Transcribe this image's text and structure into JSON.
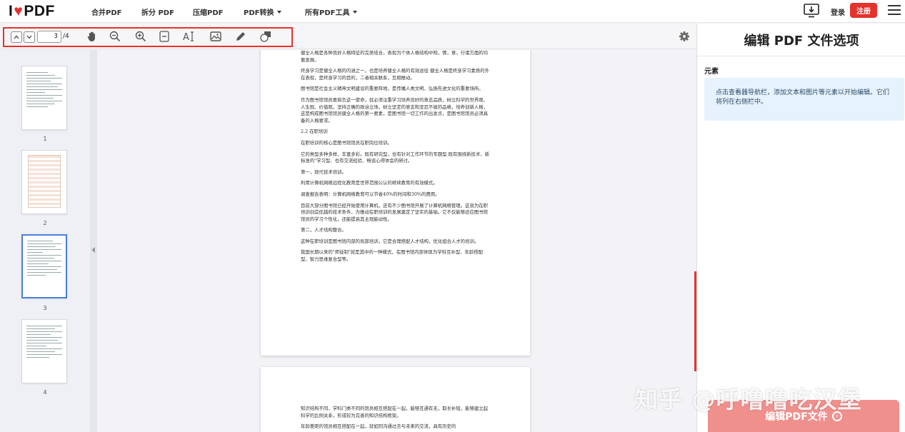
{
  "brand": {
    "logo_left": "I",
    "logo_right": "PDF",
    "accent": "#e5322d"
  },
  "nav": {
    "items": [
      "合并PDF",
      "拆分 PDF",
      "压缩PDF",
      "PDF转换",
      "所有PDF工具"
    ],
    "login": "登录",
    "signup": "注册"
  },
  "toolbar": {
    "page_current": "3",
    "page_total": "/4",
    "icons": [
      "chevron-up-icon",
      "chevron-down-icon",
      "hand-icon",
      "zoom-out-icon",
      "zoom-in-icon",
      "fit-page-icon",
      "add-text-icon",
      "add-image-icon",
      "pencil-icon",
      "shape-icon",
      "gear-icon"
    ]
  },
  "thumbs": [
    {
      "label": "1"
    },
    {
      "label": "2"
    },
    {
      "label": "3"
    },
    {
      "label": "4"
    }
  ],
  "page3": {
    "p1": "健全人格是各种良好人格特征的完美结合，表现为个体人格结构中知，情，意，行诸方面的均衡发展。",
    "p2": "终身学习是健全人格的内涵之一，也是培养健全人格的有效途径 健全人格是终身学习素质的外在表现，是终身学习的目的，二者相关联系，互相推动。",
    "p3": "图书馆是社会主义精神文明建设的重要阵地，是传播人类文明，弘扬先进文化的重要场所。",
    "p4": "作为图书馆馆员要肩负这一使命，就必须注重学习培养良好的意志品质，树立科学的世界观、人生观、价值观，坚持正确的政治立场，树立坚定的意志和坚忍不拔的品格，培养创新人格，这是构成图书馆馆员健全人格的第一要素，是图书馆一切工作的出发点，是图书馆馆员必须具备的人格要求。",
    "h1": "2.2 在职培训",
    "p5": "在职培训的核心是图书馆馆员在职岗位培训。",
    "p6": "它的类型多种多样，丰富多彩。既有研究型，也有针对工作环节的专题型 既有围绕新技术、新标准的\"学习型、也有交流经验、畅谈心得体会的研讨。",
    "p7": "第一，现代技术培训。",
    "p8": "利用计算机网络远程化教育是世界范围公认的继续教育的有效模式。",
    "p9": "调查报告表明：计算机网络教育可以节省40%的时间和30%的费用。",
    "p10": "目前大部分图书馆已经开始使用计算机，还有不少图书馆开展了计算机网络管理。这就为在职培训创造优越的技术条件，为推动在职培训的发展奠定了坚实的基础。它不仅能够适应图书馆馆员的学习个性化，还能提高其主观能动性。",
    "p11": "第二，人才结构整合。",
    "p12": "这种在职培训是图书馆内部的局部培训，它是合理搭配人才结构，优化组合人才的培训。",
    "p13": "我国长期以来的\"师徒制\"就是其中的一种模式，在图书馆内部体现为学科互补型、年龄搭配型、智力思维复合型等。"
  },
  "page4": {
    "p1": "知识结构不同，学科门类不同的馆员相互搭配在一起，能够互通有无，取长补短，能够建立起科学的比例关系，形成较为完善的知识结构框架。",
    "p2": "年龄差距的馆员相互搭配在一起，就如同沟通过去与未来的交流，具有历史的"
  },
  "rpanel": {
    "title": "编辑 PDF 文件选项",
    "section": "元素",
    "info": "点击查看器导航栏，添加文本和图片等元素以开始编辑。它们将列在右侧栏中。",
    "button": "编辑PDF文件",
    "watermark": "知乎 @呼噜噜吃汉堡"
  }
}
